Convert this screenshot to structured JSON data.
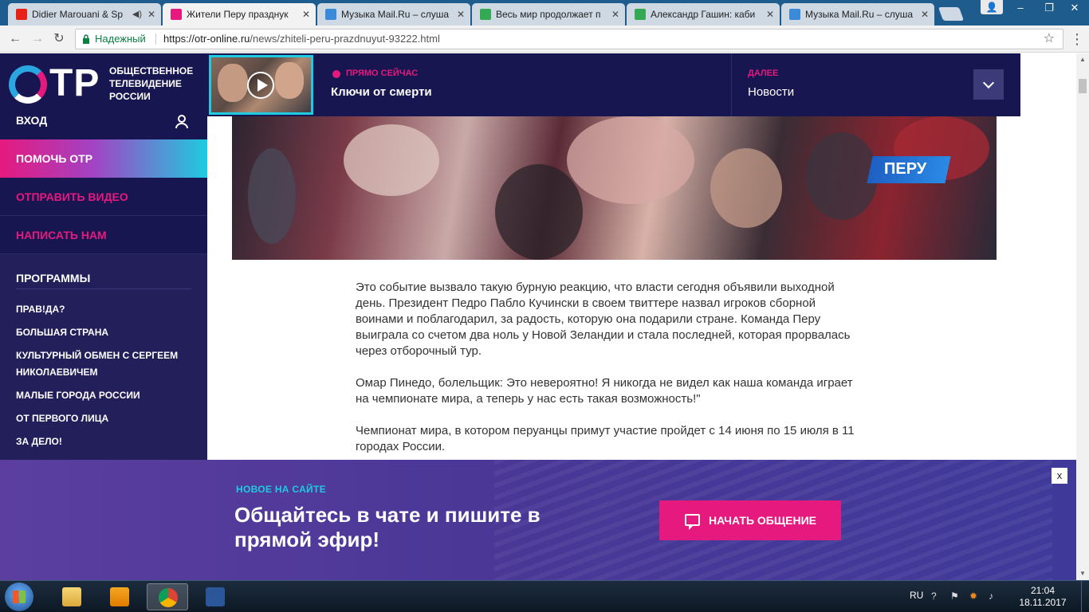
{
  "browser": {
    "tabs": [
      {
        "title": "Didier Marouani & Sp",
        "favicon_color": "#e62117",
        "icon": "youtube-icon",
        "active": false,
        "muted": true
      },
      {
        "title": "Жители Перу празднук",
        "favicon_color": "#e5197e",
        "icon": "otr-icon",
        "active": true,
        "muted": false
      },
      {
        "title": "Музыка Mail.Ru – слуша",
        "favicon_color": "#3b8ad9",
        "icon": "mailru-music-icon",
        "active": false,
        "muted": false
      },
      {
        "title": "Весь мир продолжает п",
        "favicon_color": "#34a853",
        "icon": "sheets-icon",
        "active": false,
        "muted": false
      },
      {
        "title": "Александр Гашин: каби",
        "favicon_color": "#34a853",
        "icon": "sheets-icon",
        "active": false,
        "muted": false
      },
      {
        "title": "Музыка Mail.Ru – слуша",
        "favicon_color": "#3b8ad9",
        "icon": "mailru-music-icon",
        "active": false,
        "muted": false
      }
    ],
    "address": {
      "secure_label": "Надежный",
      "url_host": "https://otr-online.ru",
      "url_path": "/news/zhiteli-peru-prazdnuyut-93222.html"
    },
    "profile_glyph": "👤"
  },
  "site": {
    "logo_letters": "ТР",
    "logo_text": "ОБЩЕСТВЕННОЕ ТЕЛЕВИДЕНИЕ РОССИИ",
    "login_label": "ВХОД",
    "help_label": "ПОМОЧЬ ОТР",
    "links": [
      "ОТПРАВИТЬ ВИДЕО",
      "НАПИСАТЬ НАМ"
    ],
    "programs_heading": "ПРОГРАММЫ",
    "programs": [
      "ПРАВ!ДА?",
      "БОЛЬШАЯ СТРАНА",
      "КУЛЬТУРНЫЙ ОБМЕН С СЕРГЕЕМ НИКОЛАЕВИЧЕМ",
      "МАЛЫЕ ГОРОДА РОССИИ",
      "ОТ ПЕРВОГО ЛИЦА",
      "ЗА ДЕЛО!"
    ],
    "accent_pink": "#e5197e",
    "accent_cyan": "#1ecbe0",
    "navy": "#181650"
  },
  "live": {
    "now_label": "ПРЯМО СЕЙЧАС",
    "now_title": "Ключи от смерти",
    "next_label": "ДАЛЕЕ",
    "next_title": "Новости"
  },
  "photo": {
    "overlay_text": "ПЕРУ"
  },
  "article": {
    "paragraphs": [
      "Это событие вызвало такую бурную реакцию, что власти сегодня объявили выходной день. Президент Педро Пабло Кучински в своем твиттере назвал игроков сборной воинами и поблагодарил, за радость, которую она подарили стране. Команда Перу выиграла со счетом два ноль у Новой Зеландии и стала последней, которая прорвалась через отборочный тур.",
      "Омар Пинедо, болельщик: Это невероятно! Я никогда не видел как наша команда играет на чемпионате мира, а теперь у нас есть такая возможность!\"",
      "Чемпионат мира, в котором перуанцы примут участие пройдет с 14 июня по 15 июля в 11 городах России."
    ]
  },
  "promo": {
    "kicker": "НОВОЕ НА САЙТЕ",
    "title": "Общайтесь в чате и пишите в прямой эфир!",
    "button_label": "НАЧАТЬ ОБЩЕНИЕ",
    "close_glyph": "x"
  },
  "taskbar": {
    "lang": "RU",
    "time": "21:04",
    "date": "18.11.2017"
  }
}
